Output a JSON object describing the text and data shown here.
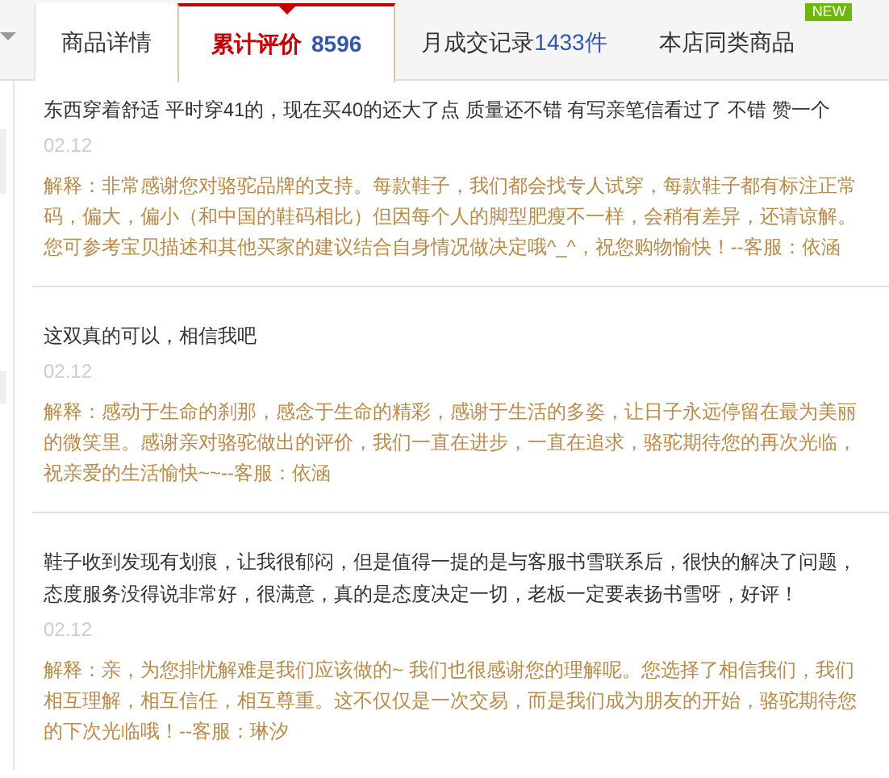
{
  "tabs": [
    {
      "label": "商品详情",
      "selected": false
    },
    {
      "label": "累计评价",
      "count": "8596",
      "selected": true
    },
    {
      "label": "月成交记录",
      "count": "1433件",
      "selected": false
    },
    {
      "label": "本店同类商品",
      "selected": false,
      "badge": "NEW"
    }
  ],
  "reviews": [
    {
      "text": "东西穿着舒适 平时穿41的，现在买40的还大了点 质量还不错 有写亲笔信看过了 不错 赞一个",
      "date": "02.12",
      "reply": "解释：非常感谢您对骆驼品牌的支持。每款鞋子，我们都会找专人试穿，每款鞋子都有标注正常码，偏大，偏小（和中国的鞋码相比）但因每个人的脚型肥瘦不一样，会稍有差异，还请谅解。您可参考宝贝描述和其他买家的建议结合自身情况做决定哦^_^，祝您购物愉快！--客服：依涵"
    },
    {
      "text": "这双真的可以，相信我吧",
      "date": "02.12",
      "reply": "解释：感动于生命的刹那，感念于生命的精彩，感谢于生活的多姿，让日子永远停留在最为美丽的微笑里。感谢亲对骆驼做出的评价，我们一直在进步，一直在追求，骆驼期待您的再次光临，祝亲爱的生活愉快~~--客服：依涵"
    },
    {
      "text": "鞋子收到发现有划痕，让我很郁闷，但是值得一提的是与客服书雪联系后，很快的解决了问题，态度服务没得说非常好，很满意，真的是态度决定一切，老板一定要表扬书雪呀，好评！",
      "date": "02.12",
      "reply": "解释：亲，为您排忧解难是我们应该做的~ 我们也很感谢您的理解呢。您选择了相信我们，我们相互理解，相互信任，相互尊重。这不仅仅是一次交易，而是我们成为朋友的开始，骆驼期待您的下次光临哦！--客服：琳汐"
    }
  ]
}
